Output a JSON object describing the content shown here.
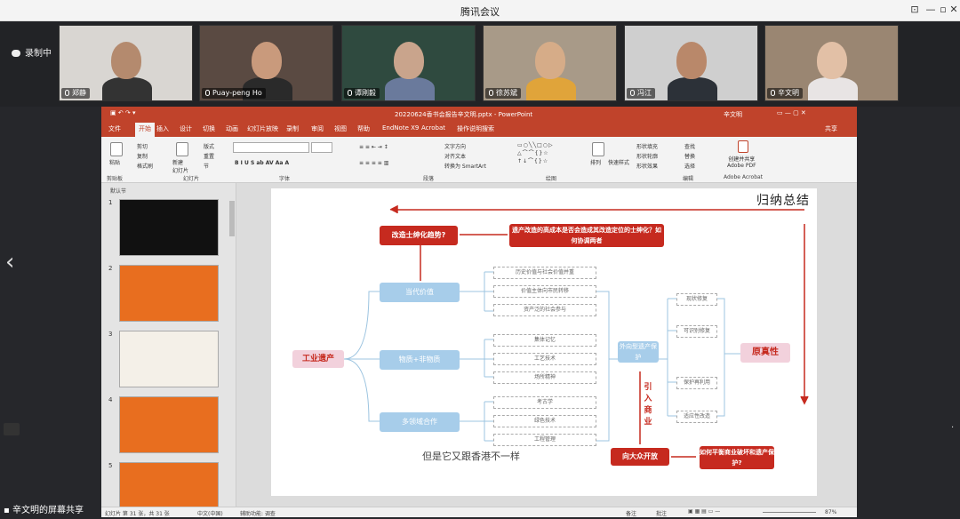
{
  "app": {
    "title": "腾讯会议"
  },
  "recording": {
    "label": "录制中"
  },
  "participants": [
    {
      "name": "郑静",
      "bg": "#d9d6d2",
      "face": "#b48a6e",
      "shirt": "#333"
    },
    {
      "name": "Puay-peng Ho",
      "bg": "#5a4a42",
      "face": "#c99a7c",
      "shirt": "#2a2a2a"
    },
    {
      "name": "谭刚毅",
      "bg": "#2f4a3f",
      "face": "#c9a48c",
      "shirt": "#6a7a9c"
    },
    {
      "name": "徐苏斌",
      "bg": "#a89a88",
      "face": "#d6ac88",
      "shirt": "#e0a43a"
    },
    {
      "name": "冯江",
      "bg": "#cfcfcf",
      "face": "#b9886a",
      "shirt": "#2c3138"
    },
    {
      "name": "辛文明",
      "bg": "#9a8672",
      "face": "#e2c0a6",
      "shirt": "#e8e4e4"
    }
  ],
  "ppt": {
    "filename": "20220624香书会报告辛文明.pptx  -  PowerPoint",
    "user": "辛文明",
    "tabs": [
      "文件",
      "开始",
      "插入",
      "设计",
      "切换",
      "动画",
      "幻灯片放映",
      "录制",
      "审阅",
      "视图",
      "帮助",
      "EndNote X9",
      "Acrobat",
      "操作说明搜索"
    ],
    "share_label": "共享",
    "groups": [
      "剪贴板",
      "幻灯片",
      "字体",
      "段落",
      "绘图",
      "编辑",
      "Adobe Acrobat"
    ],
    "buttons": {
      "paste": "粘贴",
      "cut": "剪切",
      "copy": "复制",
      "format_painter": "格式刷",
      "new_slide": "新建\n幻灯片",
      "layout": "版式",
      "reset": "重置",
      "section": "节",
      "text_direction": "文字方向",
      "align_text": "对齐文本",
      "smartart": "转换为 SmartArt",
      "arrange": "排列",
      "quick_styles": "快速样式",
      "shape_fill": "形状填充",
      "shape_outline": "形状轮廓",
      "shape_effects": "形状效果",
      "find": "查找",
      "replace": "替换",
      "select": "选择",
      "adobe": "创建并共享\nAdobe PDF"
    },
    "section": "默认节",
    "status": {
      "slide": "幻灯片 第 31 张，共 31 张",
      "lang": "中文(中国)",
      "accessibility": "辅助功能: 调查",
      "notes": "备注",
      "comments": "批注",
      "zoom": "87%"
    }
  },
  "slide": {
    "title": "归纳总结",
    "q1": "改造士绅化趋势?",
    "q2": "遗产改造的高成本是否会造成其改造定位的士绅化？如何协调两者",
    "heritage": "工业遗产",
    "branches": [
      "当代价值",
      "物质+非物质",
      "多领域合作"
    ],
    "items1": [
      "历史价值与社会价值并重",
      "价值主体向市民转移",
      "资产泛的社会参与"
    ],
    "items2": [
      "集体记忆",
      "工艺技术",
      "场所精神"
    ],
    "items3": [
      "考古学",
      "绿色技术",
      "工程管理"
    ],
    "center": "外向型遗产保护",
    "intro": "引入商业",
    "right_items": [
      "现状修复",
      "可识别修复",
      "保护再利用",
      "适应性改造"
    ],
    "authenticity": "原真性",
    "open": "向大众开放",
    "balance": "如何平衡商业破坏和遗产保护?",
    "subtitle": "但是它又跟香港不一样"
  },
  "thumbnails": [
    "1",
    "2",
    "3",
    "4",
    "5"
  ],
  "share": "辛文明的屏幕共享"
}
